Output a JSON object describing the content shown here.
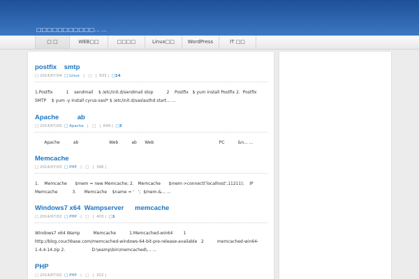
{
  "site": {
    "title": "□□□□□□□□□□□... ..."
  },
  "nav": {
    "items": [
      {
        "label": "□ □"
      },
      {
        "label": "WEB□□"
      },
      {
        "label": "□□□□"
      },
      {
        "label": "Linux□□"
      },
      {
        "label": "WordPress"
      },
      {
        "label": "IT □□"
      }
    ]
  },
  "posts": [
    {
      "title": "postfix    smtp",
      "date": "□ 2014/07/04",
      "category": "□ Linux",
      "sep1": "|",
      "mid": "□",
      "sep2": "|",
      "views": "933",
      "sep3": "|",
      "comments": "□14",
      "excerpt": "1.Postfix          1    sendmail    $ /etc/init.d/sendmail stop          2    Postfix   $ yum install Postfix 2.  Postfix    SMTP    $ yum -y install cyrus-sasl* $ /etc/init.d/saslauthd start... ..."
    },
    {
      "title": "Apache          ab",
      "date": "□ 2014/07/03",
      "category": "□ Apache",
      "sep1": "|",
      "mid": "□",
      "sep2": "|",
      "views": "649",
      "sep3": "|",
      "comments": "□3",
      "excerpt": "       Apache          ab                       Web          ab      Web                                                 PC          &n... ..."
    },
    {
      "title": "Memcache",
      "date": "□ 2014/07/03",
      "category": "□ PHP",
      "sep1": "|",
      "mid": "□",
      "sep2": "|",
      "views": "396",
      "sep3": "|",
      "comments": "",
      "excerpt": "1.    Memcache      $mem = new Memcache; 2.   Memcache      $mem->connect('localhost',11211);    IP                Memcache           3.      Memcache    $name = '   ';  $mem-&... ..."
    },
    {
      "title": "Windows7 x64  Wampserver      memcache",
      "date": "□ 2014/07/02",
      "category": "□ PHP",
      "sep1": "|",
      "mid": "□",
      "sep2": "|",
      "views": "403",
      "sep3": "|",
      "comments": "□1",
      "excerpt": "Windows7 x64 Wamp          Memcache          1.Memcached-win64        1    http://blog.couchbase.com/memcached-windows-64-bit-pre-release-available   2          memcached-win64-1.4.4-14.zip 2.                    D:\\wamp\\bin\\memcached\\... ..."
    },
    {
      "title": "PHP",
      "date": "□ 2014/07/02",
      "category": "□ PHP",
      "sep1": "|",
      "mid": "□",
      "sep2": "|",
      "views": "322",
      "sep3": "|",
      "comments": "",
      "excerpt": ""
    }
  ]
}
